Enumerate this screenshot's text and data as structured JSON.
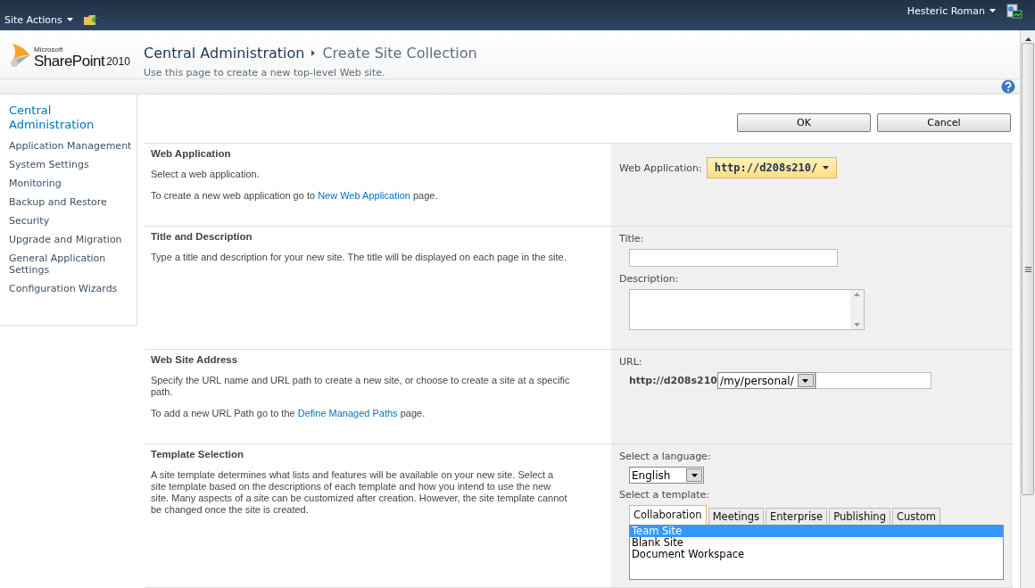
{
  "top_bar": {
    "site_actions": "Site Actions",
    "user": "Hesteric Roman"
  },
  "logo": {
    "vendor": "Microsoft",
    "product": "SharePoint",
    "version": "2010"
  },
  "breadcrumb": [
    {
      "label": "Central Administration"
    },
    {
      "label": "Create Site Collection"
    }
  ],
  "page_description": "Use this page to create a new top-level Web site.",
  "sidebar": {
    "heading": "Central Administration",
    "items": [
      {
        "label": "Application Management"
      },
      {
        "label": "System Settings"
      },
      {
        "label": "Monitoring"
      },
      {
        "label": "Backup and Restore"
      },
      {
        "label": "Security"
      },
      {
        "label": "Upgrade and Migration"
      },
      {
        "label": "General Application Settings"
      },
      {
        "label": "Configuration Wizards"
      }
    ]
  },
  "buttons": [
    "OK",
    "Cancel"
  ],
  "sections": [
    {
      "kind": "webapp",
      "title": "Web Application",
      "paragraphs": [
        {
          "before": "Select a web application."
        },
        {
          "before": "To create a new web application go to ",
          "link": "New Web Application",
          "after": " page."
        }
      ],
      "label": "Web Application:",
      "value": "http://d208s210/"
    },
    {
      "kind": "title_desc",
      "title": "Title and Description",
      "paragraphs": [
        {
          "before": "Type a title and description for your new site. The title will be displayed on each page in the site."
        }
      ],
      "title_label": "Title:",
      "description_label": "Description:"
    },
    {
      "kind": "address",
      "title": "Web Site Address",
      "paragraphs": [
        {
          "before": "Specify the URL name and URL path to create a new site, or choose to create a site at a specific path."
        },
        {
          "before": "To add a new URL Path go to the ",
          "link": "Define Managed Paths",
          "after": " page."
        }
      ],
      "label": "URL:",
      "prefix": "http://d208s210",
      "path": "/my/personal/"
    },
    {
      "kind": "template",
      "title": "Template Selection",
      "paragraphs": [
        {
          "before": "A site template determines what lists and features will be available on your new site. Select a site template based on the descriptions of each template and how you intend to use the new site. Many aspects of a site can be customized after creation. However, the site template cannot be changed once the site is created."
        }
      ],
      "language_label": "Select a language:",
      "language": "English",
      "template_label": "Select a template:",
      "tabs": [
        {
          "label": "Collaboration",
          "selected": true
        },
        {
          "label": "Meetings",
          "selected": false
        },
        {
          "label": "Enterprise",
          "selected": false
        },
        {
          "label": "Publishing",
          "selected": false
        },
        {
          "label": "Custom",
          "selected": false
        }
      ],
      "templates": [
        {
          "label": "Team Site",
          "selected": true
        },
        {
          "label": "Blank Site",
          "selected": false
        },
        {
          "label": "Document Workspace",
          "selected": false
        }
      ]
    }
  ]
}
